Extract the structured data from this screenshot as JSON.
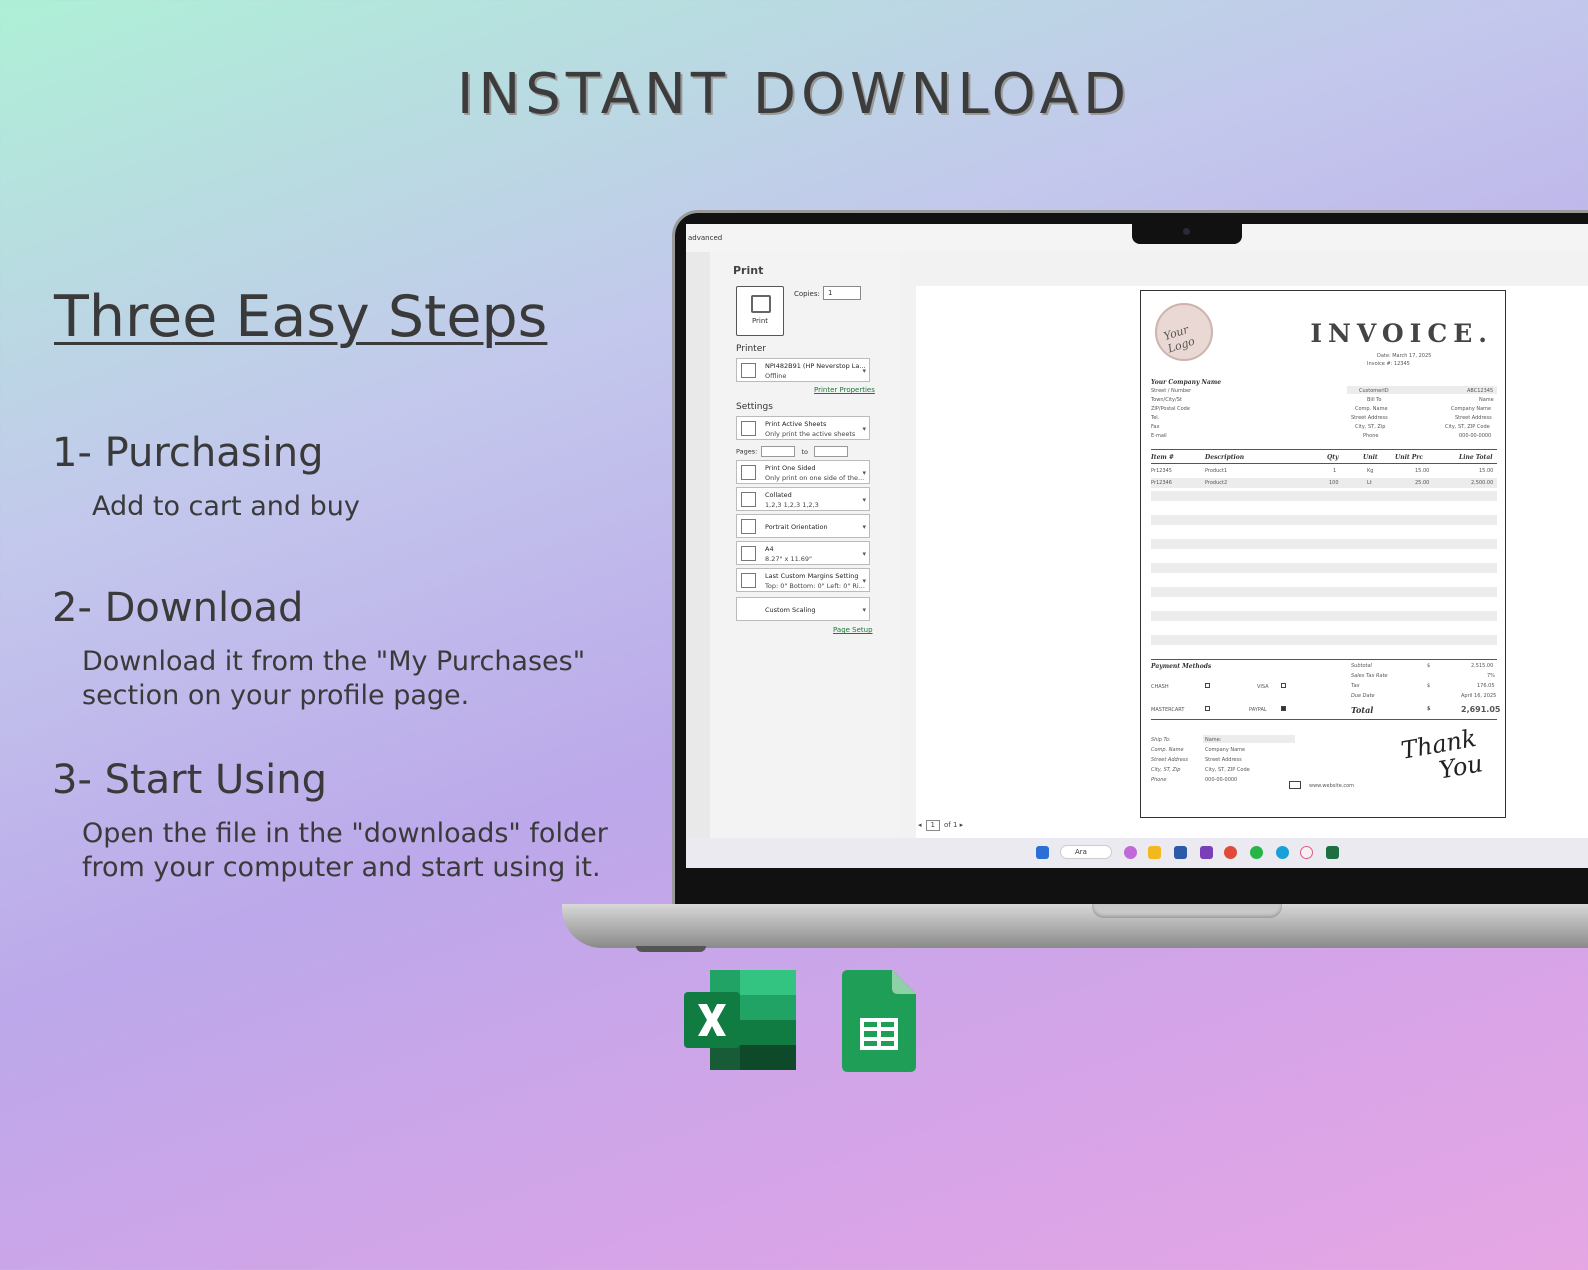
{
  "headline": "INSTANT DOWNLOAD",
  "steps_title": "Three Easy Steps",
  "steps": [
    {
      "title": "1- Purchasing",
      "lines": [
        "Add to cart and buy"
      ]
    },
    {
      "title": "2- Download",
      "lines": [
        "Download it from the \"My Purchases\"",
        "section on your profile page."
      ]
    },
    {
      "title": "3- Start Using",
      "lines": [
        "Open the file in the \"downloads\" folder",
        "from your computer and start using it."
      ]
    }
  ],
  "app": {
    "titlebar": "advanced",
    "print_title": "Print",
    "print_button": "Print",
    "copies_label": "Copies:",
    "copies_value": "1",
    "printer_label": "Printer",
    "printer_name": "NPI482B91 (HP Neverstop La...",
    "printer_status": "Offline",
    "printer_properties": "Printer Properties",
    "settings_label": "Settings",
    "settings": [
      {
        "line1": "Print Active Sheets",
        "line2": "Only print the active sheets"
      },
      {
        "line1": "Print One Sided",
        "line2": "Only print on one side of the..."
      },
      {
        "line1": "Collated",
        "line2": "1,2,3   1,2,3   1,2,3"
      },
      {
        "line1": "Portrait Orientation",
        "line2": ""
      },
      {
        "line1": "A4",
        "line2": "8.27\" x 11.69\""
      },
      {
        "line1": "Last Custom Margins Setting",
        "line2": "Top: 0\" Bottom: 0\" Left: 0\" Ri..."
      },
      {
        "line1": "Custom Scaling",
        "line2": ""
      }
    ],
    "pages_label": "Pages:",
    "pages_to": "to",
    "page_setup": "Page Setup",
    "page_nav": {
      "current": "1",
      "of": "of 1"
    },
    "taskbar_search": "Ara"
  },
  "invoice": {
    "logo_text": "Your Logo",
    "title": "INVOICE.",
    "date_line": "Date: March 17, 2025",
    "invoice_line": "Invoice #: 12345",
    "company_name": "Your Company Name",
    "company_fields": [
      "Street / Number",
      "Town/City/St",
      "ZIP/Postal Code",
      "Tel.",
      "Fax",
      "E-mail"
    ],
    "bill_labels": [
      "CustomerID",
      "Bill To",
      "Comp. Name",
      "Street Address",
      "City, ST, Zip",
      "Phone"
    ],
    "bill_values": [
      "ABC12345",
      "Name",
      "Company Name",
      "Street Address",
      "City, ST, ZIP Code",
      "000-00-0000"
    ],
    "columns": [
      "Item #",
      "Description",
      "Qty",
      "Unit",
      "Unit Prc",
      "Line Total"
    ],
    "rows": [
      [
        "Pr12345",
        "Product1",
        "1",
        "Kg",
        "15.00",
        "15.00"
      ],
      [
        "Pr12346",
        "Product2",
        "100",
        "Lt",
        "25.00",
        "2,500.00"
      ]
    ],
    "payment_title": "Payment Methods",
    "payment_methods": [
      "CHASH",
      "VISA",
      "MASTERCART",
      "PAYPAL"
    ],
    "totals_labels": [
      "Subtotal",
      "Sales Tax Rate",
      "Tax",
      "Due Date",
      "Total"
    ],
    "totals_currency": [
      "$",
      "",
      "$",
      "",
      "$"
    ],
    "totals_values": [
      "2,515.00",
      "7%",
      "176.05",
      "April 16, 2025",
      "2,691.05"
    ],
    "ship_labels": [
      "Ship To:",
      "Comp. Name",
      "Street Address",
      "City, ST, Zip",
      "Phone"
    ],
    "ship_values": [
      "Name:",
      "Company Name",
      "Street Address",
      "City, ST, ZIP Code",
      "000-00-0000"
    ],
    "website": "www.website.com",
    "thank_you": [
      "Thank",
      "You"
    ]
  },
  "colors": {
    "excel_green": "#1d6f42",
    "sheets_green": "#1e9e57"
  },
  "icons": [
    "excel-icon",
    "google-sheets-icon"
  ]
}
